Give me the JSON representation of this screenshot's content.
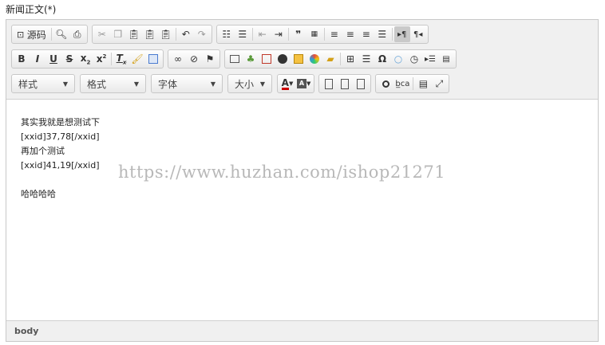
{
  "field_label": "新闻正文(*)",
  "toolbar": {
    "source_label": "源码",
    "styles_combo": "样式",
    "format_combo": "格式",
    "font_combo": "字体",
    "size_combo": "大小"
  },
  "content": {
    "lines": [
      "其实我就是想测试下",
      "[xxid]37,78[/xxid]",
      "再加个测试",
      "[xxid]41,19[/xxid]",
      "",
      "哈哈哈哈"
    ]
  },
  "watermark": "https://www.huzhan.com/ishop21271",
  "statusbar": {
    "path": "body"
  },
  "colors": {
    "toolbar_bg": "#f0f0f0",
    "border": "#c8c8c8",
    "active_button": "#c9c9c9"
  }
}
